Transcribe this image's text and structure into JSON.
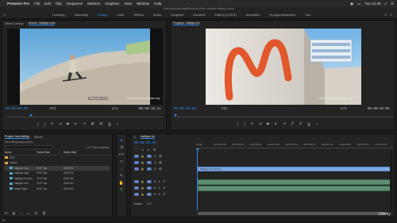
{
  "menubar": {
    "app": "Premiere Pro",
    "items": [
      "File",
      "Edit",
      "Clip",
      "Sequence",
      "Markers",
      "Graphics",
      "View",
      "Window",
      "Help"
    ],
    "clock": "Tue 21:48"
  },
  "path": "/Users/haroonbhatti/Desktop/video edit/test editing project",
  "workspaces": {
    "tabs": [
      "Learning",
      "Assembly",
      "Editing",
      "Color",
      "Effects",
      "Audio",
      "Graphics",
      "Libraries",
      "Editing (CS5.5)",
      "Animation",
      "Предустановлено",
      "Хоз"
    ],
    "active": "Editing"
  },
  "effect_controls": {
    "tab_effect": "Effect Controls",
    "tab_source": "Source: halfpipe.mp4",
    "timecode_in": "00:00:00:00",
    "fit": "Fit",
    "scale": "1/1",
    "timecode_out": "00:00:10:11",
    "drag_label": "Drag Audio Only",
    "watermark": "for educational purposes only"
  },
  "program": {
    "title": "Program: halfpipe.hd",
    "timecode_in": "00:00:00:00",
    "fit": "Fit",
    "scale": "1/4",
    "timecode_out": "00:00:04:05",
    "watermark": "for educational purposes only"
  },
  "project": {
    "tab": "Project: test editing",
    "tab2": "Effects",
    "file": "test editing project.prproj",
    "count": "1 of 17 items selected",
    "headers": [
      "Name",
      "Frame Rate",
      "Media Start"
    ],
    "rows": [
      {
        "name": "CES",
        "rate": "",
        "start": "",
        "color": "#e0a83c"
      },
      {
        "name": "Videos",
        "rate": "",
        "start": "",
        "color": "#e0a83c"
      },
      {
        "name": "halfpipe.mp4",
        "rate": "29.97 fps",
        "start": "00:00:00",
        "color": "#4fa8c9"
      },
      {
        "name": "halfpipe.mp4",
        "rate": "29.97 fps",
        "start": "00:00:00",
        "color": "#4fa8c9"
      },
      {
        "name": "halfpipe.hd mp4",
        "rate": "29.97 fps",
        "start": "00:00:00",
        "color": "#4fa8c9"
      },
      {
        "name": "halfpipe.mov",
        "rate": "29.97 fps",
        "start": "00:00:00",
        "color": "#4fa8c9"
      },
      {
        "name": "Video Right",
        "rate": "29.97 fps",
        "start": "00:00:00",
        "color": "#4fa8c9"
      }
    ]
  },
  "timeline": {
    "tab": "halfpipe.hd",
    "timecode": "00:00:00:00",
    "ruler": [
      "00:00",
      "00:00:01:00",
      "00:00:02:00",
      "00:00:03:00",
      "00:00:04:00",
      "00:00:05:00",
      "00:00:06:00",
      "00:00:07:00",
      "00:00:08:00",
      "00:00:09:00",
      "00:00:10:00"
    ],
    "tracks": [
      {
        "id": "V3",
        "kind": "video"
      },
      {
        "id": "V2",
        "kind": "video"
      },
      {
        "id": "V1",
        "kind": "video"
      },
      {
        "id": "A1",
        "kind": "audio"
      },
      {
        "id": "A2",
        "kind": "audio"
      },
      {
        "id": "A3",
        "kind": "audio"
      }
    ],
    "master": "Master",
    "master_val": "0.0",
    "clip_v1": "halfpipe.hd.mp4 [V]"
  },
  "dock": {
    "watermark": "Udemy"
  }
}
